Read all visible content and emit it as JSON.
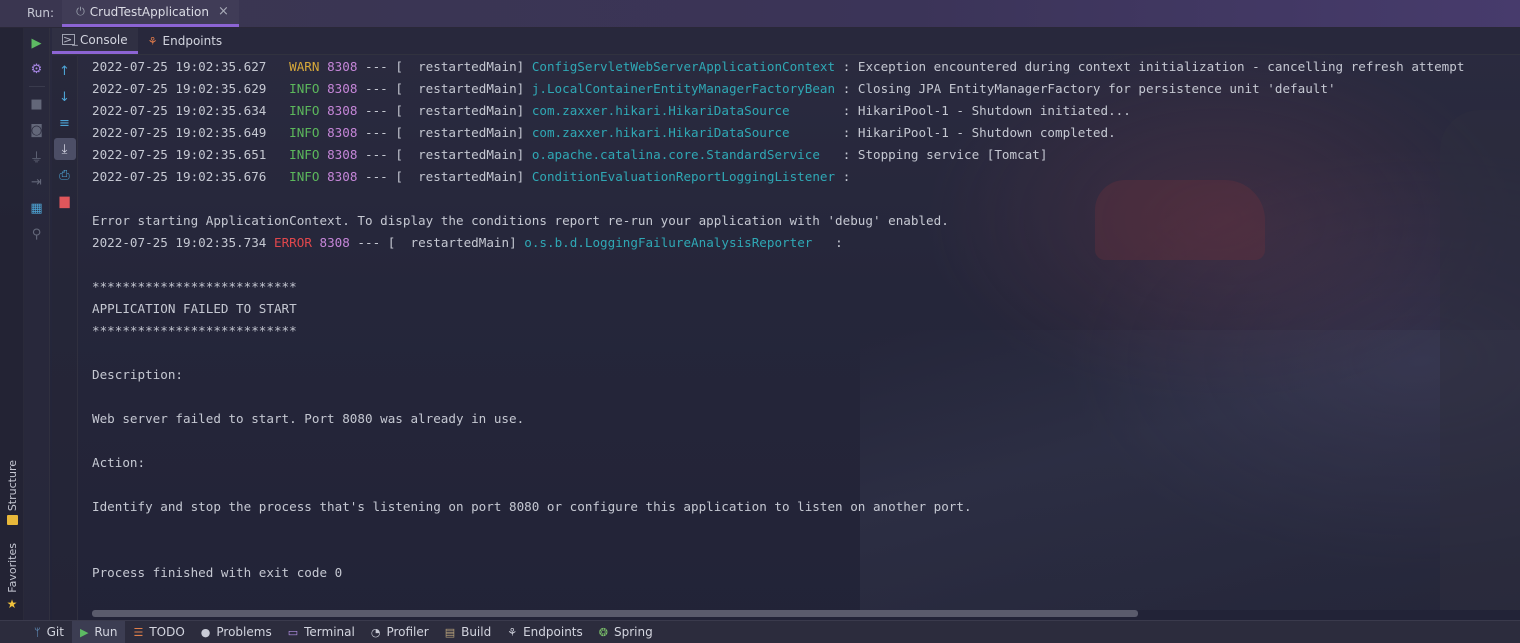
{
  "run_header": {
    "label": "Run:",
    "tab_title": "CrudTestApplication",
    "close_glyph": "×"
  },
  "console_tabs": [
    {
      "label": "Console",
      "icon": "console-icon",
      "active": true
    },
    {
      "label": "Endpoints",
      "icon": "endpoints-icon",
      "active": false
    }
  ],
  "toolbar_primary": [
    {
      "icon": "rerun-icon",
      "glyph": "▶"
    },
    {
      "icon": "settings-icon",
      "glyph": "⚙"
    },
    {
      "icon": "stop-icon",
      "glyph": "■"
    },
    {
      "icon": "camera-icon",
      "glyph": "◙"
    },
    {
      "icon": "plug-icon",
      "glyph": "⏚"
    },
    {
      "icon": "exit-icon",
      "glyph": "⇥"
    },
    {
      "icon": "layout-icon",
      "glyph": "▦"
    },
    {
      "icon": "pin-icon",
      "glyph": "📌"
    }
  ],
  "toolbar_secondary": [
    {
      "icon": "scroll-up-icon",
      "glyph": "↑"
    },
    {
      "icon": "scroll-down-icon",
      "glyph": "↓"
    },
    {
      "icon": "soft-wrap-icon",
      "glyph": "≡"
    },
    {
      "icon": "scroll-to-end-icon",
      "glyph": "⤓"
    },
    {
      "icon": "print-icon",
      "glyph": "⎙"
    },
    {
      "icon": "trash-icon",
      "glyph": "🗑"
    }
  ],
  "side_tabs": {
    "structure": "Structure",
    "favorites": "Favorites"
  },
  "log_lines": [
    {
      "ts": "2022-07-25 19:02:35.627",
      "level": " WARN",
      "pid": "8308",
      "sep": " --- [  restartedMain] ",
      "logger": "ConfigServletWebServerApplicationContext",
      "msg": " : Exception encountered during context initialization - cancelling refresh attempt",
      "cls": "lvl-warn"
    },
    {
      "ts": "2022-07-25 19:02:35.629",
      "level": " INFO",
      "pid": "8308",
      "sep": " --- [  restartedMain] ",
      "logger": "j.LocalContainerEntityManagerFactoryBean",
      "msg": " : Closing JPA EntityManagerFactory for persistence unit 'default'",
      "cls": "lvl-info"
    },
    {
      "ts": "2022-07-25 19:02:35.634",
      "level": " INFO",
      "pid": "8308",
      "sep": " --- [  restartedMain] ",
      "logger": "com.zaxxer.hikari.HikariDataSource      ",
      "msg": " : HikariPool-1 - Shutdown initiated...",
      "cls": "lvl-info"
    },
    {
      "ts": "2022-07-25 19:02:35.649",
      "level": " INFO",
      "pid": "8308",
      "sep": " --- [  restartedMain] ",
      "logger": "com.zaxxer.hikari.HikariDataSource      ",
      "msg": " : HikariPool-1 - Shutdown completed.",
      "cls": "lvl-info"
    },
    {
      "ts": "2022-07-25 19:02:35.651",
      "level": " INFO",
      "pid": "8308",
      "sep": " --- [  restartedMain] ",
      "logger": "o.apache.catalina.core.StandardService  ",
      "msg": " : Stopping service [Tomcat]",
      "cls": "lvl-info"
    },
    {
      "ts": "2022-07-25 19:02:35.676",
      "level": " INFO",
      "pid": "8308",
      "sep": " --- [  restartedMain] ",
      "logger": "ConditionEvaluationReportLoggingListener",
      "msg": " :",
      "cls": "lvl-info"
    },
    {
      "ts": "2022-07-25 19:02:35.734",
      "level": "ERROR",
      "pid": "8308",
      "sep": " --- [  restartedMain] ",
      "logger": "o.s.b.d.LoggingFailureAnalysisReporter  ",
      "msg": " :",
      "cls": "lvl-error"
    }
  ],
  "messages": {
    "error_starting": "Error starting ApplicationContext. To display the conditions report re-run your application with 'debug' enabled.",
    "stars_top": "***************************",
    "failed": "APPLICATION FAILED TO START",
    "stars_bottom": "***************************",
    "description_label": "Description:",
    "description": "Web server failed to start. Port 8080 was already in use.",
    "action_label": "Action:",
    "action": "Identify and stop the process that's listening on port 8080 or configure this application to listen on another port.",
    "exit": "Process finished with exit code 0"
  },
  "bottom_tools": [
    {
      "label": "Git",
      "icon": "git-branch-icon",
      "glyph": "ᛘ",
      "cls": "bi-git",
      "active": false
    },
    {
      "label": "Run",
      "icon": "run-icon",
      "glyph": "▶",
      "cls": "bi-run",
      "active": true
    },
    {
      "label": "TODO",
      "icon": "todo-icon",
      "glyph": "☰",
      "cls": "bi-todo",
      "active": false
    },
    {
      "label": "Problems",
      "icon": "problems-icon",
      "glyph": "●",
      "cls": "bi-problems",
      "active": false
    },
    {
      "label": "Terminal",
      "icon": "terminal-icon",
      "glyph": "▭",
      "cls": "bi-terminal",
      "active": false
    },
    {
      "label": "Profiler",
      "icon": "profiler-icon",
      "glyph": "◔",
      "cls": "bi-profiler",
      "active": false
    },
    {
      "label": "Build",
      "icon": "build-icon",
      "glyph": "▤",
      "cls": "bi-build",
      "active": false
    },
    {
      "label": "Endpoints",
      "icon": "endpoints-icon",
      "glyph": "⚘",
      "cls": "bi-endpoints",
      "active": false
    },
    {
      "label": "Spring",
      "icon": "spring-icon",
      "glyph": "❂",
      "cls": "bi-spring",
      "active": false
    }
  ]
}
